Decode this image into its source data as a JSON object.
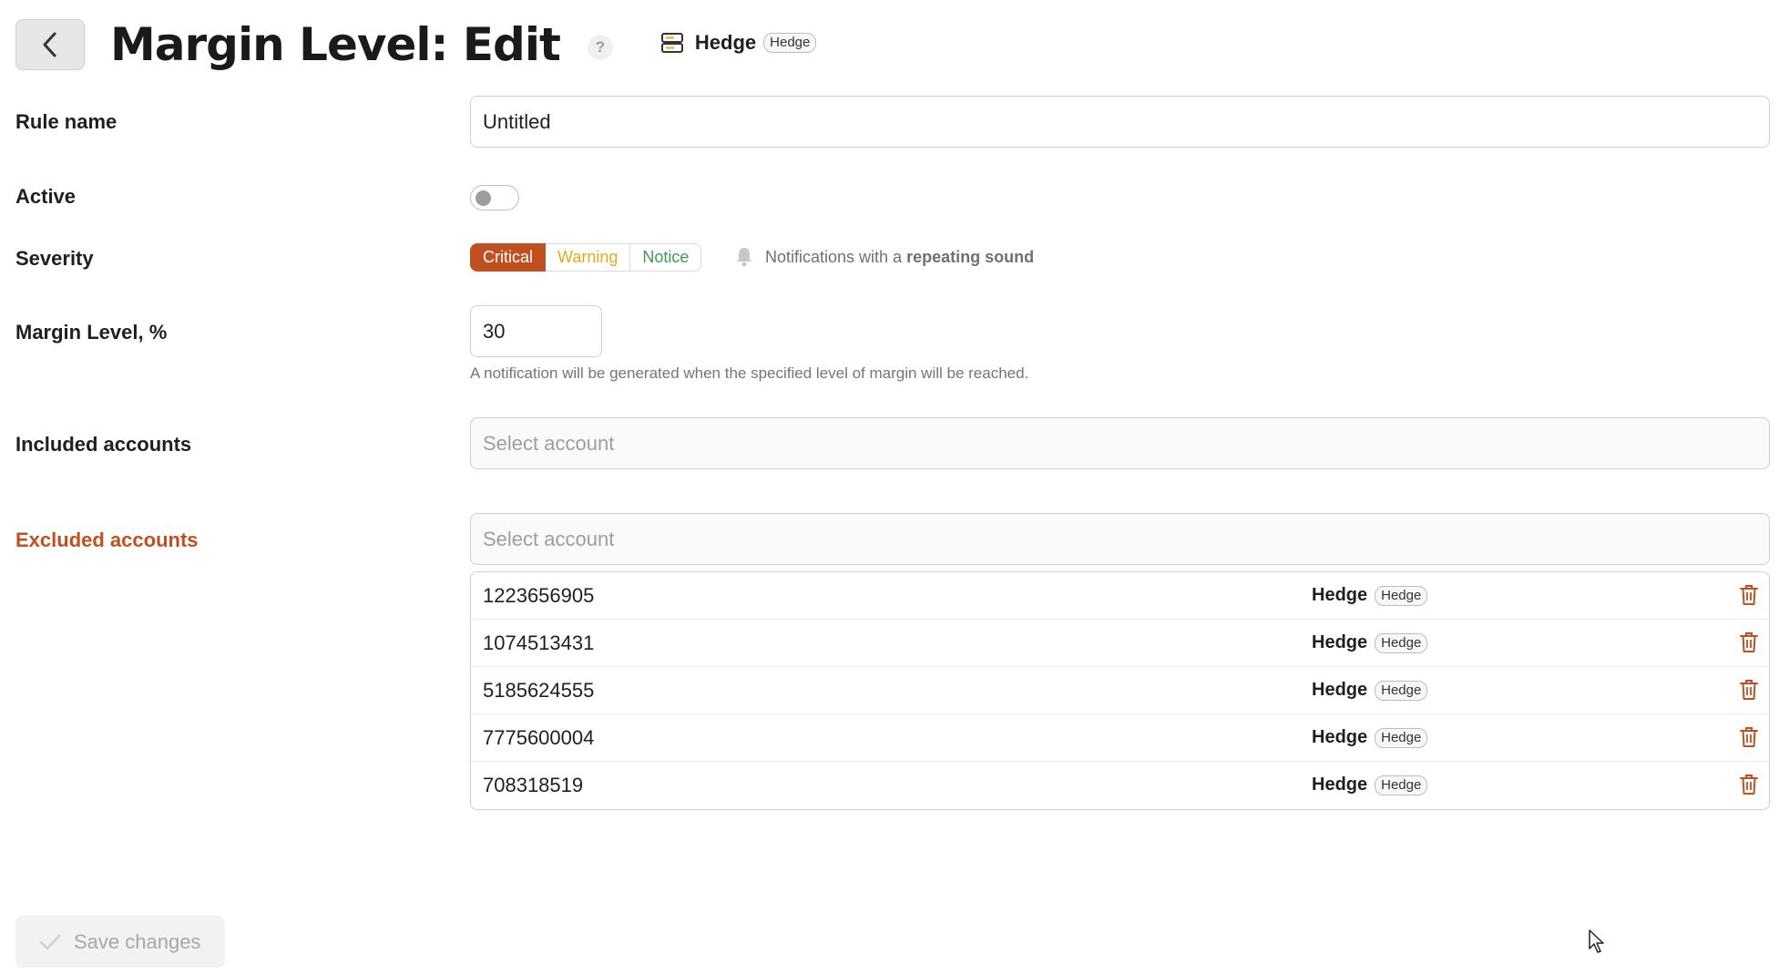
{
  "header": {
    "title": "Margin Level: Edit",
    "help_label": "?",
    "server_name": "Hedge",
    "server_tag": "Hedge",
    "back_icon": "chevron-left-icon",
    "server_icon": "server-icon"
  },
  "form": {
    "rule_name": {
      "label": "Rule name",
      "value": "Untitled"
    },
    "active": {
      "label": "Active",
      "value": false
    },
    "severity": {
      "label": "Severity",
      "options": [
        "Critical",
        "Warning",
        "Notice"
      ],
      "selected": "Critical",
      "note_prefix": "Notifications with a",
      "note_bold": "repeating sound",
      "colors": {
        "critical": "#c0501f",
        "warning": "#e2a91f",
        "notice": "#3d9a4e"
      }
    },
    "margin_level": {
      "label": "Margin Level, %",
      "value": "30",
      "hint": "A notification will be generated when the specified level of margin will be reached."
    },
    "included_accounts": {
      "label": "Included accounts",
      "placeholder": "Select account"
    },
    "excluded_accounts": {
      "label": "Excluded accounts",
      "placeholder": "Select account",
      "items": [
        {
          "number": "1223656905",
          "server": "Hedge",
          "tag": "Hedge"
        },
        {
          "number": "1074513431",
          "server": "Hedge",
          "tag": "Hedge"
        },
        {
          "number": "5185624555",
          "server": "Hedge",
          "tag": "Hedge"
        },
        {
          "number": "7775600004",
          "server": "Hedge",
          "tag": "Hedge"
        },
        {
          "number": "708318519",
          "server": "Hedge",
          "tag": "Hedge"
        }
      ]
    }
  },
  "footer": {
    "save_label": "Save changes"
  }
}
